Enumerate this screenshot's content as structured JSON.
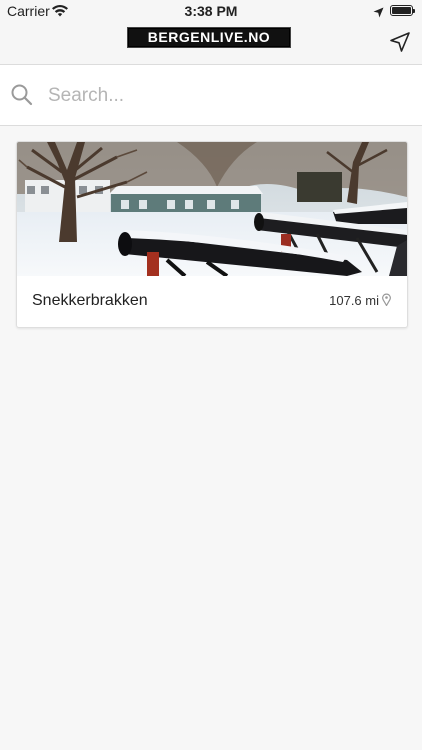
{
  "status_bar": {
    "carrier": "Carrier",
    "time": "3:38 PM"
  },
  "header": {
    "logo_text": "BERGENLIVE.NO",
    "nav_icon": "location-arrow-icon"
  },
  "search": {
    "placeholder": "Search...",
    "value": ""
  },
  "places": [
    {
      "name": "Snekkerbrakken",
      "distance": "107.6 mi"
    }
  ],
  "colors": {
    "background": "#f7f7f7",
    "bar": "#f6f6f6",
    "placeholder": "#b5b5b5"
  }
}
